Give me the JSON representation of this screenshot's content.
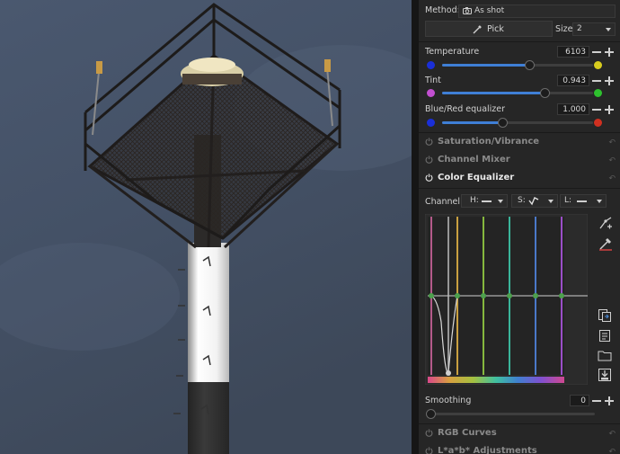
{
  "white_balance": {
    "method_label": "Method:",
    "method_icon": "camera-icon",
    "method_value": "As shot",
    "pick_label": "Pick",
    "size_label": "Size:",
    "size_value": "2",
    "temperature": {
      "label": "Temperature",
      "value": "6103",
      "level": 0.58,
      "left_color": "#1a2fd8",
      "right_color": "#d8cc1e"
    },
    "tint": {
      "label": "Tint",
      "value": "0.943",
      "level": 0.68,
      "left_color": "#c24fd0",
      "right_color": "#2ec12e"
    },
    "equalizer": {
      "label": "Blue/Red equalizer",
      "value": "1.000",
      "level": 0.4,
      "left_color": "#1a2fd8",
      "right_color": "#d03020"
    }
  },
  "tools": [
    {
      "title": "Saturation/Vibrance",
      "enabled": false
    },
    {
      "title": "Channel Mixer",
      "enabled": false
    },
    {
      "title": "Color Equalizer",
      "enabled": true
    }
  ],
  "color_equalizer": {
    "channel_label": "Channel:",
    "channels": [
      {
        "label": "H:",
        "curve_icon": "flat-curve-icon"
      },
      {
        "label": "S:",
        "curve_icon": "custom-curve-icon"
      },
      {
        "label": "L:",
        "curve_icon": "flat-curve-icon"
      }
    ],
    "smoothing_label": "Smoothing",
    "smoothing_value": "0",
    "smoothing_level": 0.0,
    "side_icons": [
      "edit-point-icon",
      "eyedropper-icon",
      "copy-icon",
      "paste-icon",
      "open-folder-icon",
      "save-icon"
    ]
  },
  "bottom_tools": [
    {
      "title": "RGB Curves",
      "enabled": false
    },
    {
      "title": "L*a*b* Adjustments",
      "enabled": false
    }
  ],
  "colors": {
    "accent": "#3f7fd6",
    "panel_bg": "#262626"
  }
}
